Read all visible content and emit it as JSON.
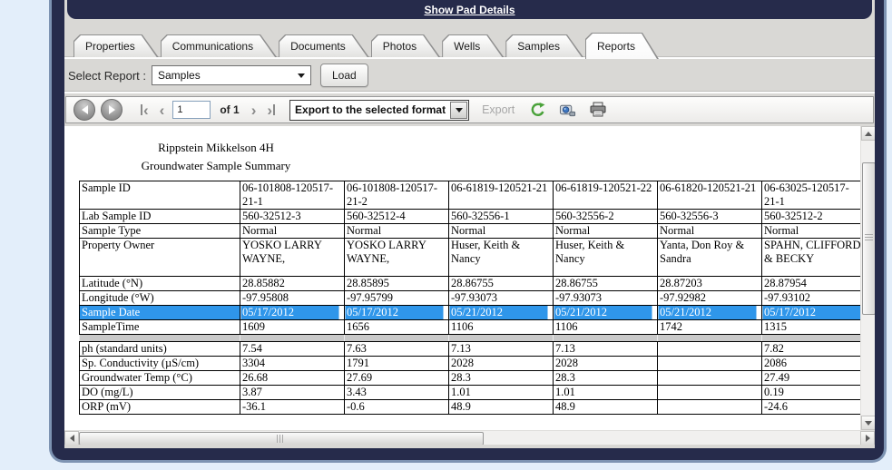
{
  "titlebar": {
    "link": "Show Pad Details"
  },
  "tabs": {
    "items": [
      "Properties",
      "Communications",
      "Documents",
      "Photos",
      "Wells",
      "Samples",
      "Reports"
    ],
    "active": "Reports"
  },
  "report_select": {
    "label": "Select Report :",
    "value": "Samples",
    "load": "Load"
  },
  "toolbar": {
    "page": "1",
    "of": "of 1",
    "export_dropdown": "Export to the selected format",
    "export_label": "Export"
  },
  "icons": {
    "back_glyph": "‹",
    "forward_glyph": "›",
    "prev_glyph": "‹",
    "next_glyph": "›"
  },
  "report": {
    "title1": "Rippstein Mikkelson 4H",
    "title2": "Groundwater Sample Summary",
    "table_rows": [
      {
        "label": "Sample ID",
        "values": [
          "06-101808-120517-21-1",
          "06-101808-120517-21-2",
          "06-61819-120521-21",
          "06-61819-120521-22",
          "06-61820-120521-21",
          "06-63025-120517-21-1"
        ]
      },
      {
        "label": "Lab Sample ID",
        "values": [
          "560-32512-3",
          "560-32512-4",
          "560-32556-1",
          "560-32556-2",
          "560-32556-3",
          "560-32512-2"
        ]
      },
      {
        "label": "Sample Type",
        "values": [
          "Normal",
          "Normal",
          "Normal",
          "Normal",
          "Normal",
          "Normal"
        ]
      },
      {
        "label": "Property Owner",
        "values": [
          "YOSKO LARRY WAYNE,",
          "YOSKO LARRY WAYNE,",
          "Huser, Keith & Nancy",
          "Huser, Keith & Nancy",
          "Yanta, Don Roy & Sandra",
          "SPAHN, CLIFFORD & BECKY"
        ],
        "style": "tall"
      },
      {
        "label": "Latitude (°N)",
        "values": [
          "28.85882",
          "28.85895",
          "28.86755",
          "28.86755",
          "28.87203",
          "28.87954"
        ]
      },
      {
        "label": "Longitude (°W)",
        "values": [
          "-97.95808",
          "-97.95799",
          "-97.93073",
          "-97.93073",
          "-97.92982",
          "-97.93102"
        ]
      },
      {
        "label": "Sample Date",
        "values": [
          "05/17/2012",
          "05/17/2012",
          "05/21/2012",
          "05/21/2012",
          "05/21/2012",
          "05/17/2012"
        ],
        "style": "selected"
      },
      {
        "label": "SampleTime",
        "values": [
          "1609",
          "1656",
          "1106",
          "1106",
          "1742",
          "1315"
        ]
      },
      {
        "label": "",
        "values": [
          "",
          "",
          "",
          "",
          "",
          ""
        ],
        "style": "spacer"
      },
      {
        "label": "ph (standard units)",
        "values": [
          "7.54",
          "7.63",
          "7.13",
          "7.13",
          "",
          "7.82"
        ]
      },
      {
        "label": "Sp. Conductivity (µS/cm)",
        "values": [
          "3304",
          "1791",
          "2028",
          "2028",
          "",
          "2086"
        ]
      },
      {
        "label": "Groundwater Temp (°C)",
        "values": [
          "26.68",
          "27.69",
          "28.3",
          "28.3",
          "",
          "27.49"
        ]
      },
      {
        "label": "DO (mg/L)",
        "values": [
          "3.87",
          "3.43",
          "1.01",
          "1.01",
          "",
          "0.19"
        ]
      },
      {
        "label": "ORP (mV)",
        "values": [
          "-36.1",
          "-0.6",
          "48.9",
          "48.9",
          "",
          "-24.6"
        ]
      }
    ]
  },
  "colors": {
    "selection": "#2f96ea",
    "frame_navy": "#262b4b",
    "frame_ring": "#7d93b2"
  }
}
